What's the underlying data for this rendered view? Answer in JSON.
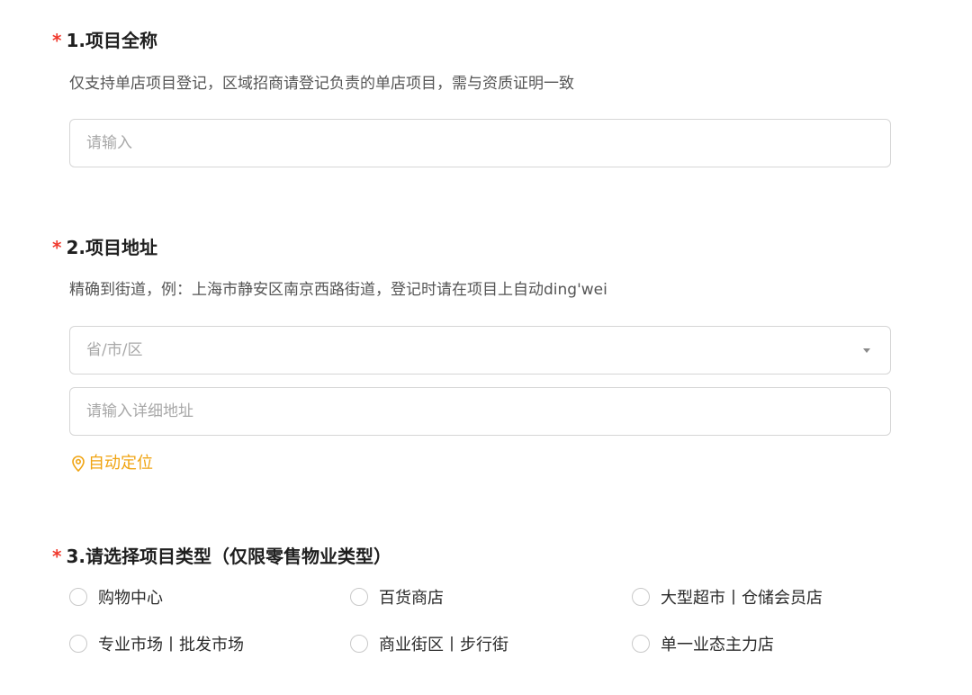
{
  "q1": {
    "number_title": "1.项目全称",
    "required_mark": "*",
    "description": "仅支持单店项目登记，区域招商请登记负责的单店项目，需与资质证明一致",
    "input_placeholder": "请输入"
  },
  "q2": {
    "number_title": "2.项目地址",
    "required_mark": "*",
    "description": "精确到街道，例：上海市静安区南京西路街道，登记时请在项目上自动ding'wei",
    "region_select_value": "省/市/区",
    "detail_input_placeholder": "请输入详细地址",
    "locate_label": "自动定位"
  },
  "q3": {
    "number_title": "3.请选择项目类型（仅限零售物业类型）",
    "required_mark": "*",
    "options": [
      "购物中心",
      "百货商店",
      "大型超市丨仓储会员店",
      "专业市场丨批发市场",
      "商业街区丨步行街",
      "单一业态主力店"
    ]
  },
  "colors": {
    "required": "#f03a2e",
    "locate_accent": "#f0a412",
    "border": "#d6d6d6",
    "placeholder": "#a8a8a8"
  },
  "icons": {
    "locate": "location-pin-icon",
    "select_caret": "caret-down-icon"
  }
}
